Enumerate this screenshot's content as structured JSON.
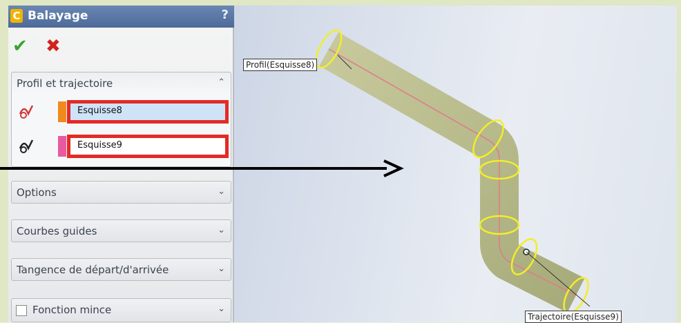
{
  "property_manager": {
    "title": "Balayage",
    "help": "?",
    "sections": {
      "profile_path": {
        "title": "Profil et trajectoire",
        "profile_value": "Esquisse8",
        "path_value": "Esquisse9"
      },
      "options": {
        "title": "Options"
      },
      "guide_curves": {
        "title": "Courbes guides"
      },
      "tangency": {
        "title": "Tangence de départ/d'arrivée"
      },
      "thin_feature": {
        "title": "Fonction mince",
        "checked": false
      }
    }
  },
  "viewport": {
    "profile_callout": "Profil(Esquisse8)",
    "path_callout": "Trajectoire(Esquisse9)"
  },
  "colors": {
    "highlight_box": "#e32a27",
    "profile_chip": "#f08a1f",
    "path_chip": "#e85aa0",
    "pipe_body": "#b9bd8e",
    "section_ellipse": "#f2ee2a"
  }
}
